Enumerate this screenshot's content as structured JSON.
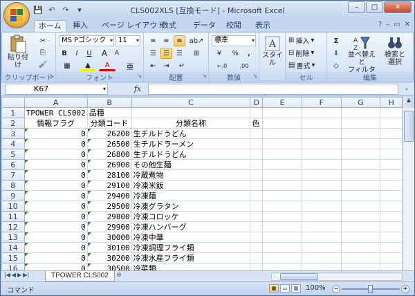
{
  "window": {
    "title": "CLS002XLS  [互換モード] - Microsoft Excel",
    "buttons": {
      "minimize": "–",
      "maximize": "□",
      "close": "✕"
    }
  },
  "qat": {
    "save": "💾",
    "undo": "↶",
    "redo": "↷",
    "customize": "▾"
  },
  "tabs": [
    {
      "label": "ホーム",
      "active": true
    },
    {
      "label": "挿入"
    },
    {
      "label": "ページ レイアウト"
    },
    {
      "label": "数式"
    },
    {
      "label": "データ"
    },
    {
      "label": "校閲"
    },
    {
      "label": "表示"
    }
  ],
  "tabs_right": {
    "help": "?",
    "min": "–",
    "restore": "▭",
    "close": "✕"
  },
  "ribbon": {
    "clipboard": {
      "label": "クリップボード",
      "paste": "貼り付け"
    },
    "font": {
      "label": "フォント",
      "name": "MS Pゴシック",
      "size": "11",
      "bold": "B",
      "italic": "I",
      "underline": "U",
      "grow": "A",
      "shrink": "A",
      "color": "A"
    },
    "align": {
      "label": "配置"
    },
    "number": {
      "label": "数値",
      "format": "標準",
      "percent": "%",
      "comma": ",",
      "inc": "←.0",
      "dec": ".00"
    },
    "styles": {
      "label": "スタイル"
    },
    "cells": {
      "label": "セル",
      "insert": "挿入",
      "delete": "削除",
      "format": "書式"
    },
    "edit": {
      "label": "編集",
      "sort": "並べ替えと",
      "sort2": "フィルタ",
      "find": "検索と",
      "find2": "選択"
    }
  },
  "formula_bar": {
    "namebox": "K67",
    "fx": "fx",
    "content": ""
  },
  "sheet": {
    "columns": [
      "A",
      "B",
      "C",
      "D",
      "E",
      "F",
      "G",
      "H"
    ],
    "rows": [
      {
        "n": "1",
        "a": "TPOWER CLS002",
        "b": "品種",
        "c": "",
        "d": ""
      },
      {
        "n": "2",
        "a": "情報フラグ",
        "b": "分類コード",
        "c": "分類名称",
        "d": "色"
      },
      {
        "n": "3",
        "a": "0",
        "b": "26200",
        "c": "生チルドうどん",
        "d": ""
      },
      {
        "n": "4",
        "a": "0",
        "b": "26500",
        "c": "生チルドラーメン",
        "d": ""
      },
      {
        "n": "5",
        "a": "0",
        "b": "26800",
        "c": "生チルドうどん",
        "d": ""
      },
      {
        "n": "6",
        "a": "0",
        "b": "26900",
        "c": "その他生麺",
        "d": ""
      },
      {
        "n": "7",
        "a": "0",
        "b": "28100",
        "c": "冷蔵煮物",
        "d": ""
      },
      {
        "n": "8",
        "a": "0",
        "b": "29100",
        "c": "冷凍米飯",
        "d": ""
      },
      {
        "n": "9",
        "a": "0",
        "b": "29400",
        "c": "冷凍麺",
        "d": ""
      },
      {
        "n": "10",
        "a": "0",
        "b": "29500",
        "c": "冷凍グラタン",
        "d": ""
      },
      {
        "n": "11",
        "a": "0",
        "b": "29800",
        "c": "冷凍コロッケ",
        "d": ""
      },
      {
        "n": "12",
        "a": "0",
        "b": "29900",
        "c": "冷凍ハンバーグ",
        "d": ""
      },
      {
        "n": "13",
        "a": "0",
        "b": "30000",
        "c": "冷凍中華",
        "d": ""
      },
      {
        "n": "14",
        "a": "0",
        "b": "30100",
        "c": "冷凍調理フライ類",
        "d": ""
      },
      {
        "n": "15",
        "a": "0",
        "b": "30200",
        "c": "冷凍水産フライ類",
        "d": ""
      },
      {
        "n": "16",
        "a": "0",
        "b": "30500",
        "c": "冷菜類",
        "d": ""
      }
    ]
  },
  "sheet_tabs": {
    "active": "TPOWER CLS002"
  },
  "status": {
    "mode": "コマンド",
    "zoom": "100%",
    "zoom_fraction": 0.5
  }
}
